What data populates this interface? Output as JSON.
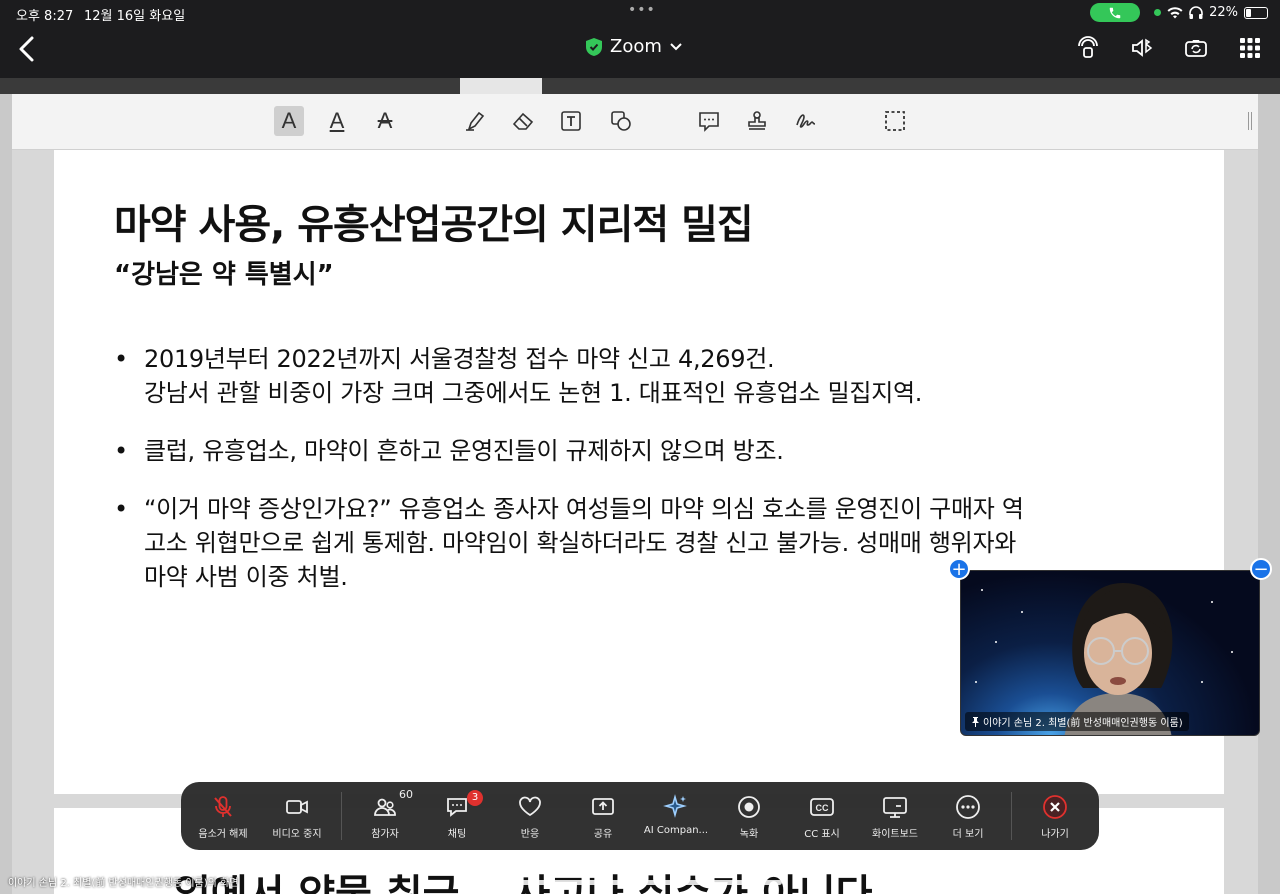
{
  "status_bar": {
    "time": "오후 8:27",
    "date": "12월 16일 화요일",
    "battery": "22%",
    "battery_fraction": 0.22
  },
  "nav": {
    "title": "Zoom",
    "back_icon": "chevron-left-icon",
    "shield_color": "#34c759",
    "icons": [
      "audio-route-icon",
      "speaker-bluetooth-icon",
      "camera-switch-icon",
      "grid-view-icon"
    ]
  },
  "annotation_tools": [
    "text-format-icon",
    "text-underline-icon",
    "text-strike-icon",
    "highlighter-icon",
    "eraser-icon",
    "textbox-icon",
    "shape-icon",
    "comment-icon",
    "stamp-icon",
    "signature-icon",
    "select-area-icon"
  ],
  "slide": {
    "title": "마약 사용, 유흥산업공간의 지리적 밀집",
    "subtitle": "“강남은 약 특별시”",
    "bullets": [
      [
        "2019년부터 2022년까지 서울경찰청 접수 마약 신고 4,269건.",
        "강남서 관할 비중이 가장 크며 그중에서도 논현 1. 대표적인 유흥업소 밀집지역."
      ],
      [
        "클럽, 유흥업소, 마약이 흔하고 운영진들이 규제하지 않으며 방조."
      ],
      [
        "“이거 마약 증상인가요?” 유흥업소 종사자 여성들의 마약 의심 호소를 운영진이 구매자 역",
        "고소 위협만으로 쉽게 통제함. 마약임이 확실하더라도 경찰 신고 불가능. 성매매 행위자와",
        "마약 사범 이중 처벌."
      ]
    ],
    "next_slide_peek": "…업에서 약물 취급… 사고나 실수가 아니다"
  },
  "video_tile": {
    "participant_label": "이야기 손님 2. 최별(前 반성매매인권행동 이룸)",
    "pin_icon": "pin-icon"
  },
  "toolbar": {
    "items": [
      {
        "label": "음소거 해제",
        "icon": "mic-muted-icon"
      },
      {
        "label": "비디오 중지",
        "icon": "video-icon"
      },
      {
        "label": "참가자",
        "icon": "participants-icon",
        "count": "60"
      },
      {
        "label": "채팅",
        "icon": "chat-icon",
        "badge": "3"
      },
      {
        "label": "반응",
        "icon": "heart-icon"
      },
      {
        "label": "공유",
        "icon": "share-icon"
      },
      {
        "label": "AI Compan...",
        "icon": "ai-sparkle-icon"
      },
      {
        "label": "녹화",
        "icon": "record-icon"
      },
      {
        "label": "CC 표시",
        "icon": "cc-icon"
      },
      {
        "label": "화이트보드",
        "icon": "whiteboard-icon"
      },
      {
        "label": "더 보기",
        "icon": "more-icon"
      },
      {
        "label": "나가기",
        "icon": "leave-icon"
      }
    ],
    "leave_color": "#e0312e"
  },
  "bottom_caption": "이야기 손님 2. 최별(前 반성매매인권행동 이룸)의 화면"
}
